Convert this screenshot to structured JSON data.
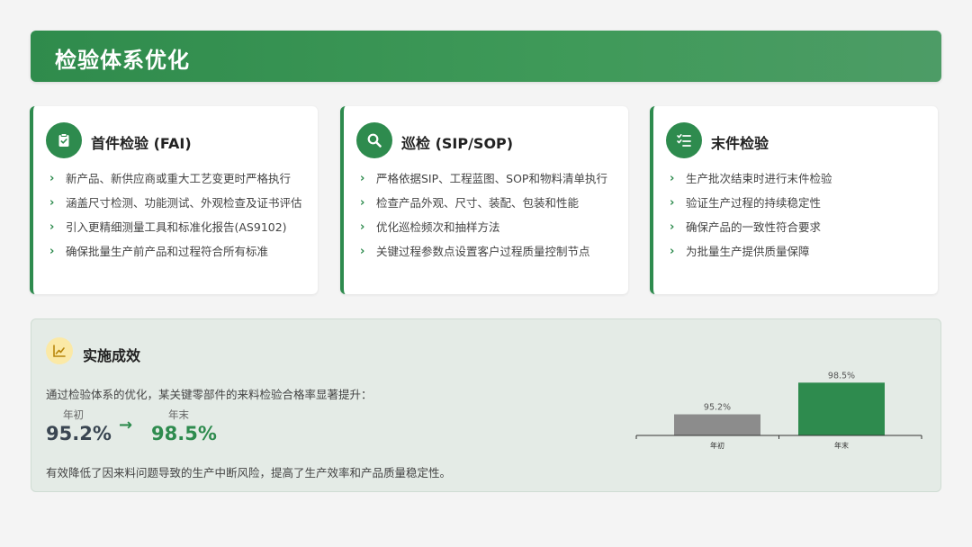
{
  "header": {
    "title": "检验体系优化"
  },
  "cards": [
    {
      "title": "首件检验 (FAI)",
      "icon": "clipboard-check-icon",
      "items": [
        "新产品、新供应商或重大工艺变更时严格执行",
        "涵盖尺寸检测、功能测试、外观检查及证书评估",
        "引入更精细测量工具和标准化报告(AS9102)",
        "确保批量生产前产品和过程符合所有标准"
      ]
    },
    {
      "title": "巡检 (SIP/SOP)",
      "icon": "search-icon",
      "items": [
        "严格依据SIP、工程蓝图、SOP和物料清单执行",
        "检查产品外观、尺寸、装配、包装和性能",
        "优化巡检频次和抽样方法",
        "关键过程参数点设置客户过程质量控制节点"
      ]
    },
    {
      "title": "末件检验",
      "icon": "checklist-icon",
      "items": [
        "生产批次结束时进行末件检验",
        "验证生产过程的持续稳定性",
        "确保产品的一致性符合要求",
        "为批量生产提供质量保障"
      ]
    }
  ],
  "results": {
    "title": "实施成效",
    "icon": "trend-chart-icon",
    "intro": "通过检验体系的优化，某关键零部件的来料检验合格率显著提升：",
    "before_label": "年初",
    "before_value": "95.2%",
    "after_label": "年末",
    "after_value": "98.5%",
    "outro": "有效降低了因来料问题导致的生产中断风险，提高了生产效率和产品质量稳定性。"
  },
  "colors": {
    "accent": "#2e8b4e",
    "before_bar": "#8c8c8c",
    "after_bar": "#2e8b4e",
    "before_text": "#3a4652"
  },
  "chart_data": {
    "type": "bar",
    "categories": [
      "年初",
      "年末"
    ],
    "values": [
      95.2,
      98.5
    ],
    "data_labels": [
      "95.2%",
      "98.5%"
    ],
    "ylim": [
      93,
      99
    ]
  }
}
